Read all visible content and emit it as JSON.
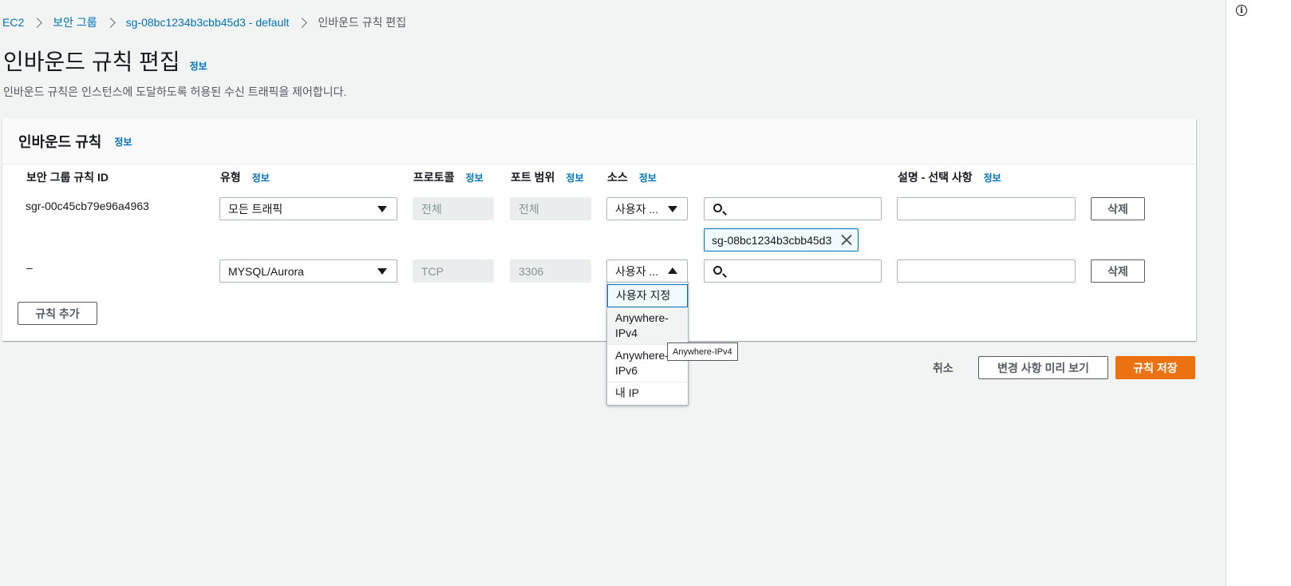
{
  "breadcrumb": {
    "items": [
      "EC2",
      "보안 그룹",
      "sg-08bc1234b3cbb45d3 - default"
    ],
    "current": "인바운드 규칙 편집"
  },
  "page": {
    "title": "인바운드 규칙 편집",
    "info": "정보",
    "description": "인바운드 규칙은 인스턴스에 도달하도록 허용된 수신 트래픽을 제어합니다."
  },
  "panel": {
    "title": "인바운드 규칙",
    "info": "정보",
    "columns": {
      "rule_id": "보안 그룹 규칙 ID",
      "type": "유형",
      "protocol": "프로토콜",
      "port_range": "포트 범위",
      "source": "소스",
      "description": "설명 - 선택 사항",
      "info": "정보"
    },
    "rows": [
      {
        "rule_id": "sgr-00c45cb79e96a4963",
        "type": "모든 트래픽",
        "protocol": "전체",
        "port_range": "전체",
        "source": "사용자 ...",
        "token": "sg-08bc1234b3cbb45d3",
        "delete": "삭제"
      },
      {
        "rule_id": "–",
        "type": "MYSQL/Aurora",
        "protocol": "TCP",
        "port_range": "3306",
        "source": "사용자 ...",
        "delete": "삭제"
      }
    ],
    "add_rule": "규칙 추가"
  },
  "source_dropdown": {
    "options": [
      "사용자 지정",
      "Anywhere-IPv4",
      "Anywhere-IPv6",
      "내 IP"
    ],
    "option_lines": [
      [
        "사용자 지정"
      ],
      [
        "Anywhere-",
        "IPv4"
      ],
      [
        "Anywhere-",
        "IPv6"
      ],
      [
        "내 IP"
      ]
    ]
  },
  "tooltip": "Anywhere-IPv4",
  "footer": {
    "cancel": "취소",
    "preview": "변경 사항 미리 보기",
    "save": "규칙 저장"
  },
  "right_rail": {
    "icon": "info-icon"
  }
}
